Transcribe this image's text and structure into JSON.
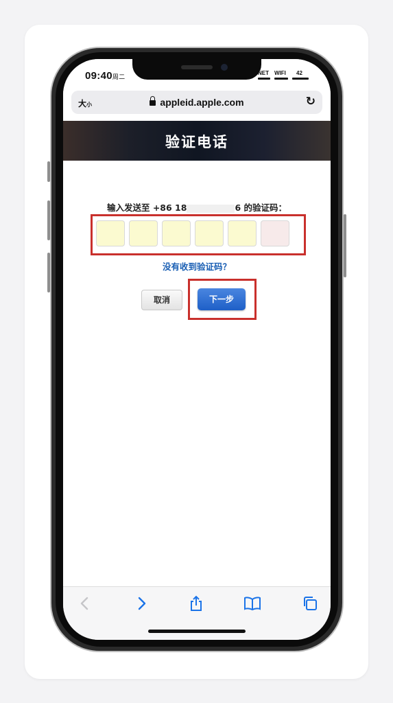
{
  "status_bar": {
    "time": "09:40",
    "weekday": "周二",
    "network": "NET",
    "wifi": "WIFI",
    "battery": "42"
  },
  "browser": {
    "text_size_label": "大",
    "text_size_small": "小",
    "url": "appleid.apple.com"
  },
  "page": {
    "title": "验证电话",
    "prompt_prefix": "输入发送至 +86 18",
    "prompt_suffix": "6 的验证码：",
    "no_code_link": "没有收到验证码？",
    "cancel_label": "取消",
    "next_label": "下一步",
    "code_cells": 6
  },
  "toolbar": {
    "icons": [
      "chevron-left-icon",
      "chevron-right-icon",
      "share-icon",
      "bookmarks-icon",
      "tabs-icon"
    ]
  }
}
